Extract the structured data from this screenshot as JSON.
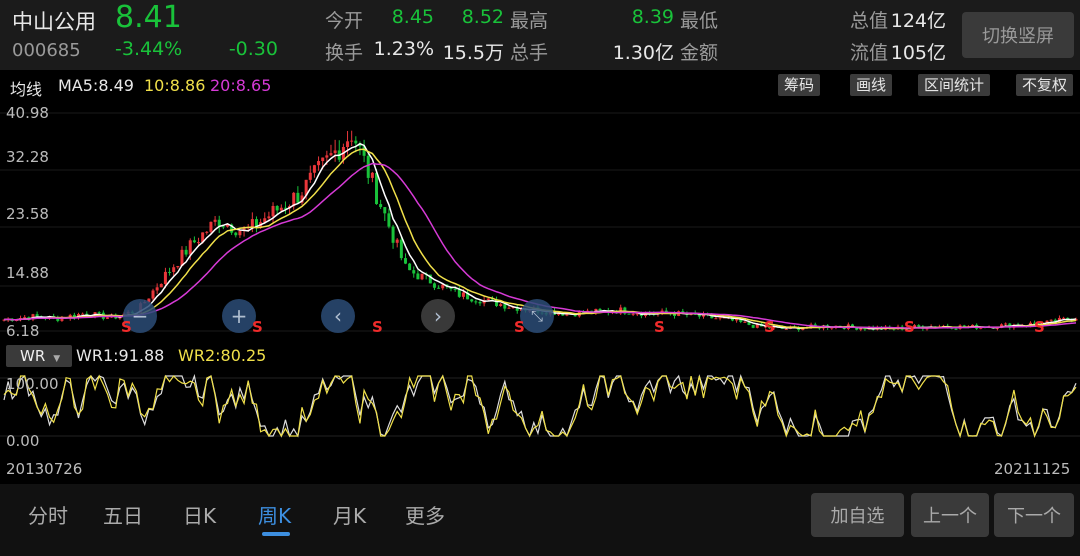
{
  "stock": {
    "name": "中山公用",
    "code": "000685",
    "price": "8.41",
    "change_pct": "-3.44%",
    "change": "-0.30"
  },
  "stats": [
    {
      "label": "今开",
      "value": "8.45",
      "color": "green"
    },
    {
      "label": "最高",
      "value": "8.52",
      "color": "green"
    },
    {
      "label": "最低",
      "value": "8.39",
      "color": "green"
    },
    {
      "label": "总值",
      "value": "124亿",
      "color": "white"
    },
    {
      "label": "换手",
      "value": "1.23%",
      "color": "white"
    },
    {
      "label": "总手",
      "value": "15.5万",
      "color": "white"
    },
    {
      "label": "金额",
      "value": "1.30亿",
      "color": "white"
    },
    {
      "label": "流值",
      "value": "105亿",
      "color": "white"
    }
  ],
  "switch_label": "切换竖屏",
  "ma": {
    "title": "均线",
    "ma5": "MA5:8.49",
    "ma10": "10:8.86",
    "ma20": "20:8.65"
  },
  "tools": [
    "筹码",
    "画线",
    "区间统计",
    "不复权"
  ],
  "chart_data": {
    "type": "candlestick",
    "price_ticks": [
      "40.98",
      "32.28",
      "23.58",
      "14.88",
      "6.18"
    ],
    "ylim": [
      6.18,
      40.98
    ],
    "price_profile": [
      8,
      8.5,
      8.2,
      9,
      8.3,
      9.5,
      15,
      20,
      24,
      22,
      25,
      28,
      33,
      38,
      27,
      16,
      14,
      12,
      11,
      10,
      9.5,
      9,
      9.2,
      9.5,
      9,
      9,
      8.5,
      8,
      7,
      6.5,
      6.8,
      7,
      6.7,
      6.5,
      6.8,
      7,
      6.8,
      7,
      7.2,
      7.5,
      8.4
    ],
    "signal_label": "S",
    "x_start": "20130726",
    "x_end": "20211125",
    "colors": {
      "ma5": "#ffffff",
      "ma10": "#f0e04a",
      "ma20": "#d63ad6",
      "up": "#e8363a",
      "down": "#19c23a"
    }
  },
  "wr": {
    "selector": "WR",
    "wr1": "WR1:91.88",
    "wr2": "WR2:80.25",
    "ticks": [
      "100.00",
      "0.00"
    ]
  },
  "period_tabs": [
    "分时",
    "五日",
    "日K",
    "周K",
    "月K",
    "更多"
  ],
  "active_tab": "周K",
  "bottom_buttons": [
    "加自选",
    "上一个",
    "下一个"
  ]
}
